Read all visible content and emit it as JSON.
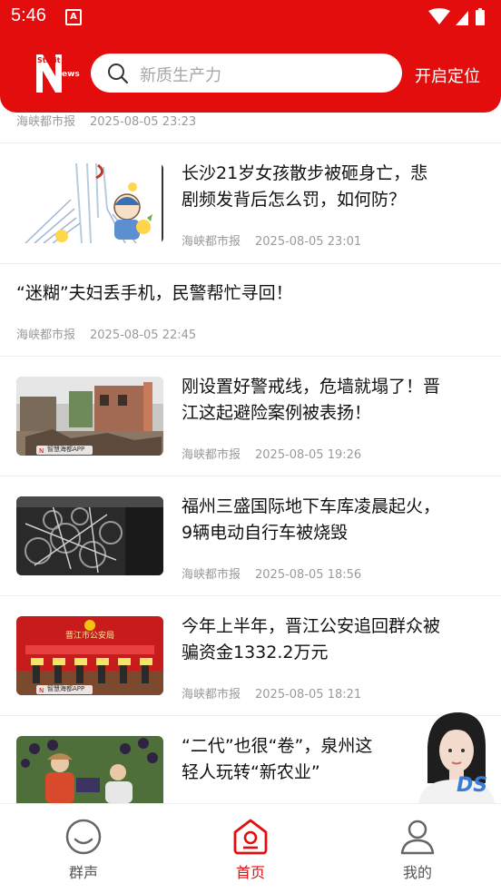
{
  "status_bar": {
    "time": "5:46"
  },
  "header": {
    "logo_text": "StraitNews",
    "search_placeholder": "新质生产力",
    "locate_label": "开启定位"
  },
  "feed": [
    {
      "source": "海峡都市报",
      "time": "2025-08-05 23:23"
    },
    {
      "title_lines": [
        "长沙21岁女孩散步被砸身亡，悲",
        "剧频发背后怎么罚，如何防？"
      ],
      "source": "海峡都市报",
      "time": "2025-08-05 23:01",
      "image": "cartoon-illustration"
    },
    {
      "title": "“迷糊”夫妇丢手机，民警帮忙寻回！",
      "source": "海峡都市报",
      "time": "2025-08-05 22:45"
    },
    {
      "title_lines": [
        "刚设置好警戒线，危墙就塌了！晋",
        "江这起避险案例被表扬！"
      ],
      "source": "海峡都市报",
      "time": "2025-08-05 19:26",
      "image_watermark": "智慧海都APP"
    },
    {
      "title_lines": [
        "福州三盛国际地下车库凌晨起火，",
        "9辆电动自行车被烧毁"
      ],
      "source": "海峡都市报",
      "time": "2025-08-05 18:56"
    },
    {
      "title_lines": [
        "今年上半年，晋江公安追回群众被",
        "骗资金1332.2万元"
      ],
      "source": "海峡都市报",
      "time": "2025-08-05 18:21",
      "image_watermark": "智慧海都APP",
      "image_text": "晋江市公安局"
    },
    {
      "title_lines": [
        "“二代”也很“卷”，泉州这",
        "轻人玩转“新农业”"
      ]
    }
  ],
  "tabs": [
    {
      "label": "群声",
      "icon": "smile-face-icon",
      "active": false
    },
    {
      "label": "首页",
      "icon": "home-icon",
      "active": true
    },
    {
      "label": "我的",
      "icon": "person-icon",
      "active": false
    }
  ],
  "floating_assistant": {
    "badge": "DS"
  },
  "colors": {
    "brand_red": "#e30d0d",
    "meta_gray": "#9a9a9a"
  }
}
